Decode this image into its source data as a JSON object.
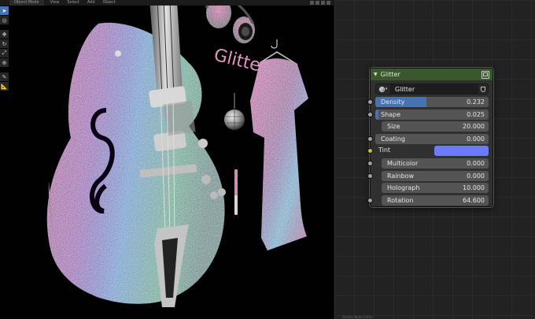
{
  "viewport": {
    "header": {
      "mode": "Object Mode",
      "menus": [
        "View",
        "Select",
        "Add",
        "Object"
      ]
    },
    "tools": [
      "select-tool",
      "cursor-tool",
      "move-tool",
      "rotate-tool",
      "scale-tool",
      "transform-tool",
      "annotate-tool",
      "measure-tool"
    ],
    "scene": {
      "sign_text": "Glitter"
    }
  },
  "node_editor": {
    "bottom_text": "Shader Node Editor",
    "node": {
      "title": "Glitter",
      "header_color": "#39582c",
      "group_name": "Glitter",
      "inputs": [
        {
          "label": "Density",
          "value": "0.232",
          "fill": 0.454,
          "indent": false,
          "socket": "gray"
        },
        {
          "label": "Shape",
          "value": "0.025",
          "fill": 0.025,
          "indent": false,
          "socket": "gray"
        },
        {
          "label": "Size",
          "value": "20.000",
          "fill": 0,
          "indent": true,
          "socket": "none"
        },
        {
          "label": "Coating",
          "value": "0.000",
          "fill": 0,
          "indent": false,
          "socket": "gray"
        },
        {
          "label": "Tint",
          "value": "",
          "type": "color",
          "color": "#6b7bff",
          "socket": "yellow"
        },
        {
          "label": "Multicolor",
          "value": "0.000",
          "fill": 0,
          "indent": true,
          "socket": "gray"
        },
        {
          "label": "Rainbow",
          "value": "0.000",
          "fill": 0,
          "indent": true,
          "socket": "gray"
        },
        {
          "label": "Holograph",
          "value": "10.000",
          "fill": 0,
          "indent": true,
          "socket": "none"
        },
        {
          "label": "Rotation",
          "value": "64.600",
          "fill": 0,
          "indent": true,
          "socket": "gray"
        }
      ]
    }
  }
}
